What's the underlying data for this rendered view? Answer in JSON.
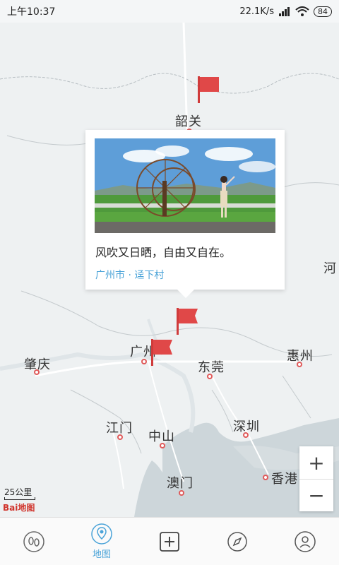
{
  "status": {
    "time": "上午10:37",
    "net_speed": "22.1K/s",
    "battery": "84"
  },
  "map": {
    "cities": [
      "韶关",
      "广州",
      "东莞",
      "惠州",
      "肇庆",
      "江门",
      "中山",
      "深圳",
      "香港",
      "澳门",
      "河"
    ],
    "scale_label": "25公里",
    "logo_text": "Bai地图"
  },
  "popup": {
    "caption": "风吹又日晒，自由又自在。",
    "place": "广州市 · 迳下村"
  },
  "zoom": {
    "in": "+",
    "out": "−"
  },
  "nav": {
    "items": [
      "footprint-icon",
      "map-icon",
      "add-icon",
      "compass-icon",
      "profile-icon"
    ],
    "map_label": "地图",
    "active_color": "#4aa3d8"
  }
}
